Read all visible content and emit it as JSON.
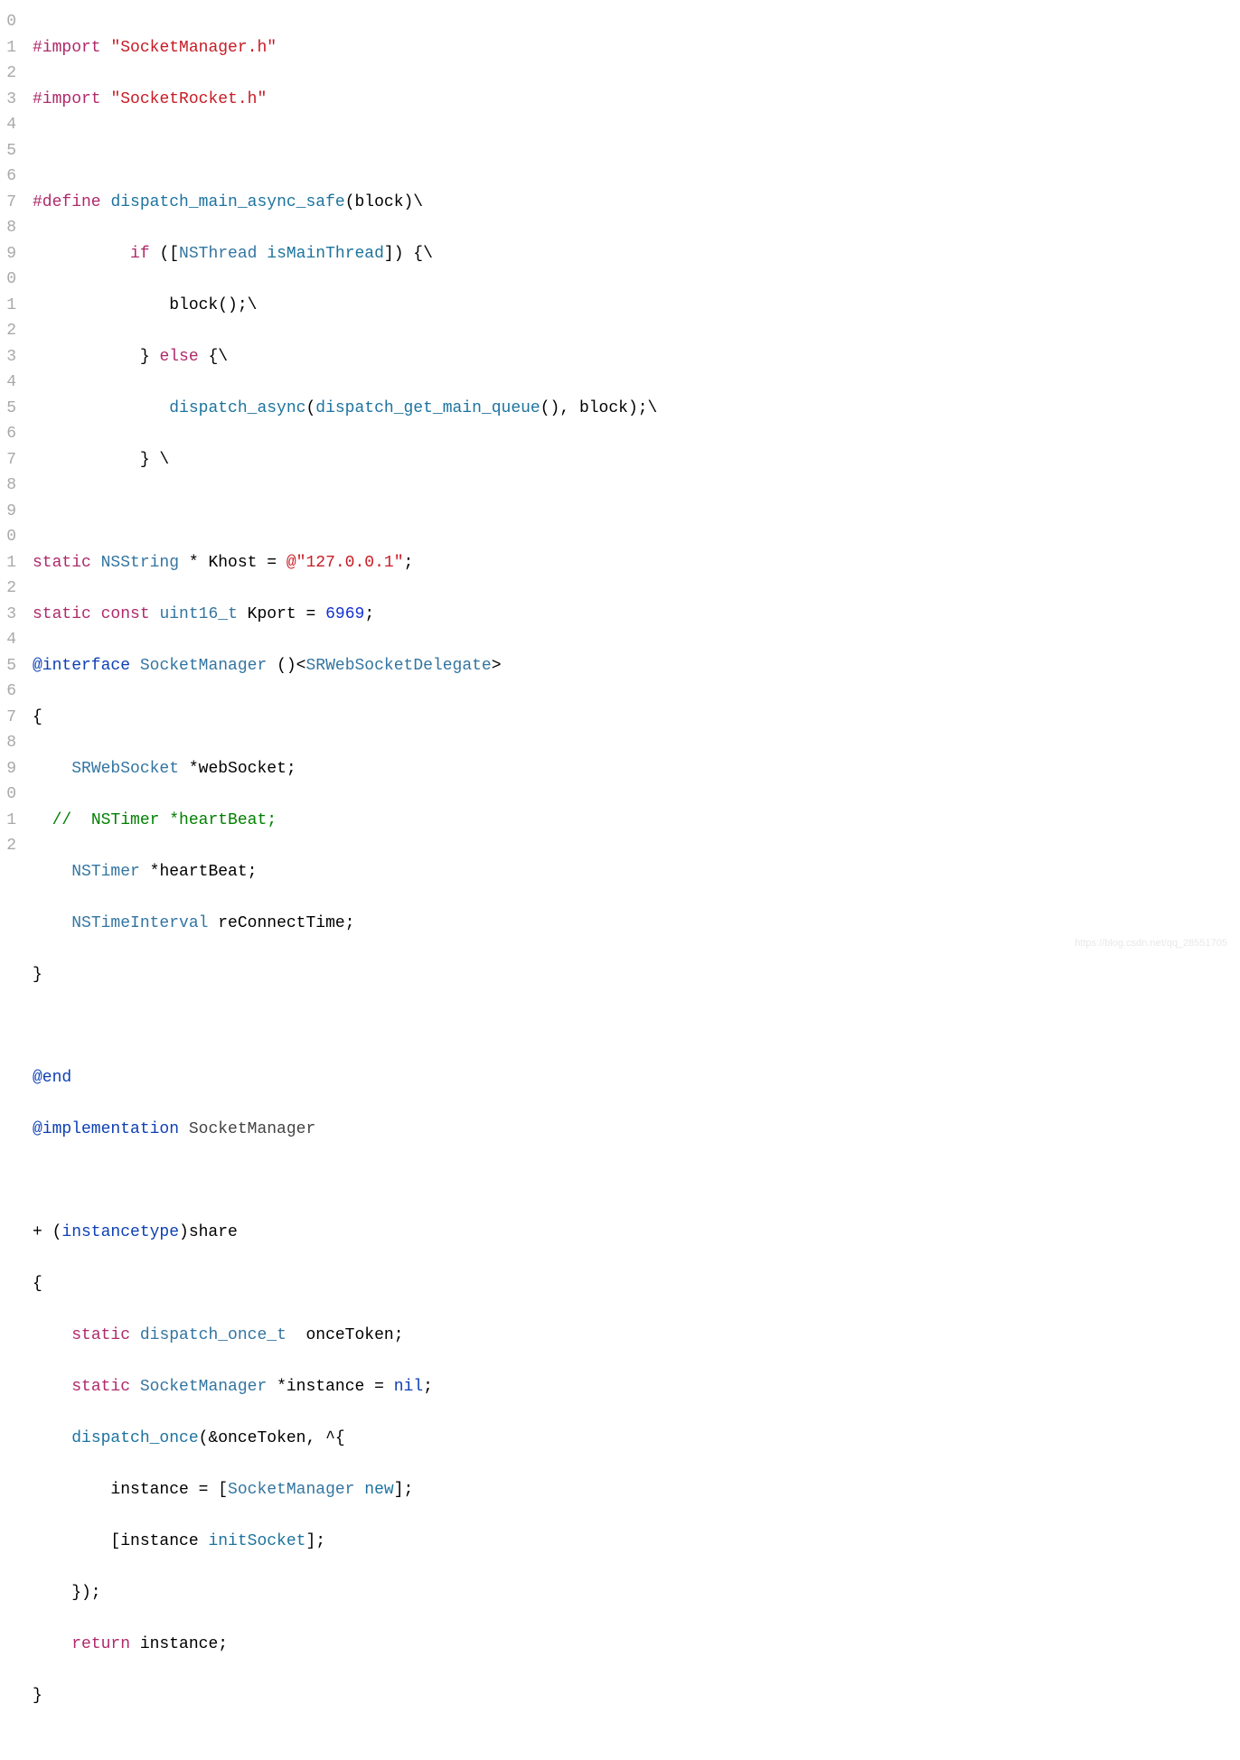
{
  "line_numbers": [
    "0",
    "1",
    "2",
    "3",
    "4",
    "5",
    "6",
    "7",
    "8",
    "9",
    "0",
    "1",
    "2",
    "3",
    "4",
    "5",
    "6",
    "7",
    "8",
    "9",
    "0",
    "1",
    "2",
    "3",
    "4",
    "5",
    "6",
    "7",
    "8",
    "9",
    "0",
    "1",
    "2"
  ],
  "code": {
    "l0": {
      "t0": "#import",
      "t1": " ",
      "t2": "\"SocketManager.h\""
    },
    "l1": {
      "t0": "#import",
      "t1": " ",
      "t2": "\"SocketRocket.h\""
    },
    "l2": {
      "t0": ""
    },
    "l3": {
      "t0": "#define",
      "t1": " ",
      "t2": "dispatch_main_async_safe",
      "t3": "(block)\\"
    },
    "l4": {
      "t0": "          ",
      "t1": "if",
      "t2": " ([",
      "t3": "NSThread",
      "t4": " ",
      "t5": "isMainThread",
      "t6": "]) {\\"
    },
    "l5": {
      "t0": "              block();\\"
    },
    "l6": {
      "t0": "           } ",
      "t1": "else",
      "t2": " {\\"
    },
    "l7": {
      "t0": "              ",
      "t1": "dispatch_async",
      "t2": "(",
      "t3": "dispatch_get_main_queue",
      "t4": "(), block);\\"
    },
    "l8": {
      "t0": "           } \\"
    },
    "l9": {
      "t0": ""
    },
    "l10": {
      "t0": "static",
      "t1": " ",
      "t2": "NSString",
      "t3": " * Khost = ",
      "t4": "@\"127.0.0.1\"",
      "t5": ";"
    },
    "l11": {
      "t0": "static",
      "t1": " ",
      "t2": "const",
      "t3": " ",
      "t4": "uint16_t",
      "t5": " Kport = ",
      "t6": "6969",
      "t7": ";"
    },
    "l12": {
      "t0": "@interface",
      "t1": " ",
      "t2": "SocketManager",
      "t3": " ()<",
      "t4": "SRWebSocketDelegate",
      "t5": ">"
    },
    "l13": {
      "t0": "{"
    },
    "l14": {
      "t0": "    ",
      "t1": "SRWebSocket",
      "t2": " *webSocket;"
    },
    "l15": {
      "t0": "  ",
      "t1": "//  NSTimer *heartBeat;"
    },
    "l16": {
      "t0": "    ",
      "t1": "NSTimer",
      "t2": " *heartBeat;"
    },
    "l17": {
      "t0": "    ",
      "t1": "NSTimeInterval",
      "t2": " reConnectTime;"
    },
    "l18": {
      "t0": "}"
    },
    "l19": {
      "t0": ""
    },
    "l20": {
      "t0": "@end"
    },
    "l21": {
      "t0": "@implementation",
      "t1": " ",
      "t2": "SocketManager"
    },
    "l22": {
      "t0": ""
    },
    "l23": {
      "t0": "+ (",
      "t1": "instancetype",
      "t2": ")share"
    },
    "l24": {
      "t0": "{"
    },
    "l25": {
      "t0": "    ",
      "t1": "static",
      "t2": " ",
      "t3": "dispatch_once_t",
      "t4": "  onceToken;"
    },
    "l26": {
      "t0": "    ",
      "t1": "static",
      "t2": " ",
      "t3": "SocketManager",
      "t4": " *instance = ",
      "t5": "nil",
      "t6": ";"
    },
    "l27": {
      "t0": "    ",
      "t1": "dispatch_once",
      "t2": "(&onceToken, ^{"
    },
    "l28": {
      "t0": "        instance = [",
      "t1": "SocketManager",
      "t2": " ",
      "t3": "new",
      "t4": "];"
    },
    "l29": {
      "t0": "        [instance ",
      "t1": "initSocket",
      "t2": "];"
    },
    "l30": {
      "t0": "    });"
    },
    "l31": {
      "t0": "    ",
      "t1": "return",
      "t2": " instance;"
    },
    "l32": {
      "t0": "}"
    }
  },
  "watermark": "https://blog.csdn.net/qq_28551705"
}
